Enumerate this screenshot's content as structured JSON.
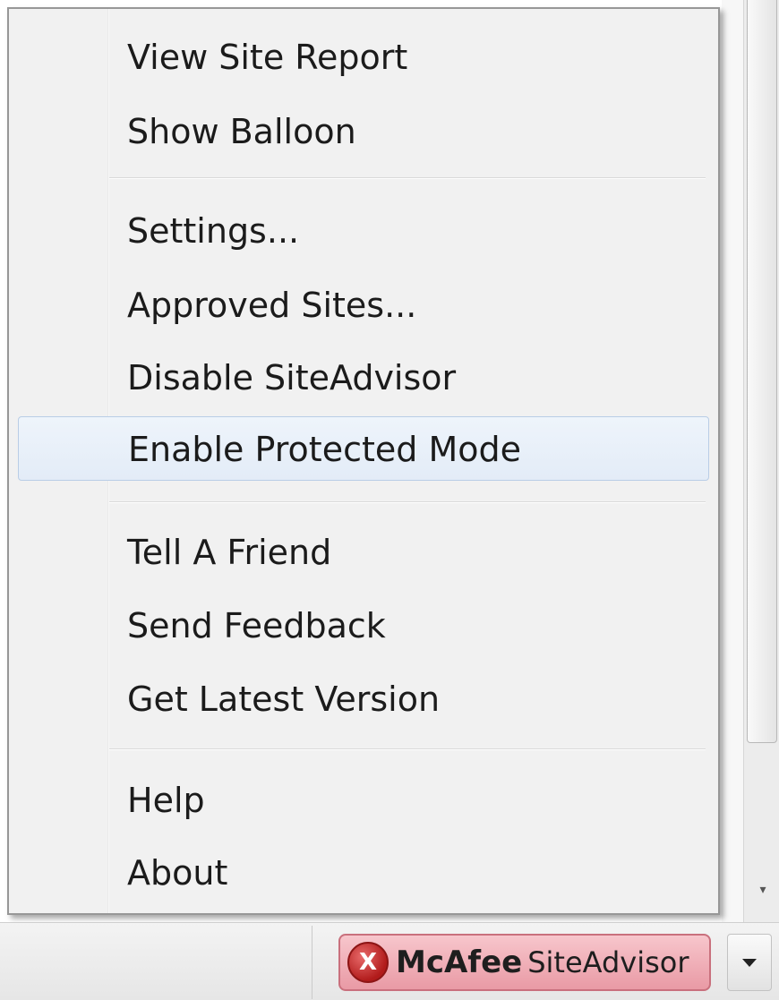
{
  "menu": {
    "groups": [
      [
        "View Site Report",
        "Show Balloon"
      ],
      [
        "Settings...",
        "Approved Sites...",
        "Disable SiteAdvisor",
        "Enable Protected Mode"
      ],
      [
        "Tell A Friend",
        "Send Feedback",
        "Get Latest Version"
      ],
      [
        "Help",
        "About"
      ]
    ],
    "highlighted_item": "Enable Protected Mode"
  },
  "statusbar": {
    "siteadvisor": {
      "icon": "x-icon",
      "icon_glyph": "X",
      "brand": "McAfee",
      "product": "SiteAdvisor",
      "status_color": "#e99aa5"
    },
    "dropdown_icon": "chevron-down-icon"
  }
}
